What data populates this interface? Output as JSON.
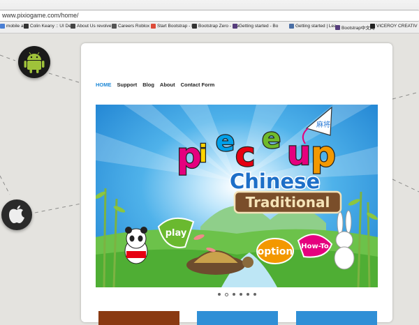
{
  "browser": {
    "url": "www.pixiogame.com/home/",
    "bookmarks": [
      {
        "label": "mobile app",
        "color": "#4a7fd4"
      },
      {
        "label": "Colin Keany :: UI De",
        "color": "#333333"
      },
      {
        "label": "About Us revolve",
        "color": "#444444"
      },
      {
        "label": "Careers Roblox",
        "color": "#555555"
      },
      {
        "label": "Start Bootstrap - Fr",
        "color": "#dd4b39"
      },
      {
        "label": "Bootstrap Zero - Fre",
        "color": "#333333"
      },
      {
        "label": "Getting started - Bo",
        "color": "#563d7c"
      },
      {
        "label": "Getting started | Lea",
        "color": "#4a6fa5"
      },
      {
        "label": "Bootstrap中文网",
        "color": "#563d7c"
      },
      {
        "label": "VICEROY CREATIV",
        "color": "#222222"
      }
    ]
  },
  "nav": {
    "items": [
      {
        "label": "HOME",
        "active": true
      },
      {
        "label": "Support",
        "active": false
      },
      {
        "label": "Blog",
        "active": false
      },
      {
        "label": "About",
        "active": false
      },
      {
        "label": "Contact Form",
        "active": false
      }
    ]
  },
  "banner": {
    "logo_letters": [
      "p",
      "i",
      "e",
      "c",
      "e",
      "u",
      "p"
    ],
    "logo_colors": [
      "#e5007e",
      "#ffd400",
      "#00a0e9",
      "#e60012",
      "#6fba2c",
      "#e5007e",
      "#f39800"
    ],
    "subtitle": "Chinese",
    "ribbon": "Traditional",
    "play_label": "play",
    "option_label": "option",
    "howto_label": "How-To",
    "kite_text": "麻将"
  },
  "slider": {
    "count": 6,
    "active_index": 1
  },
  "thumbnails": [
    "#8a3a12",
    "#2f8fd6",
    "#2f8fd6"
  ]
}
